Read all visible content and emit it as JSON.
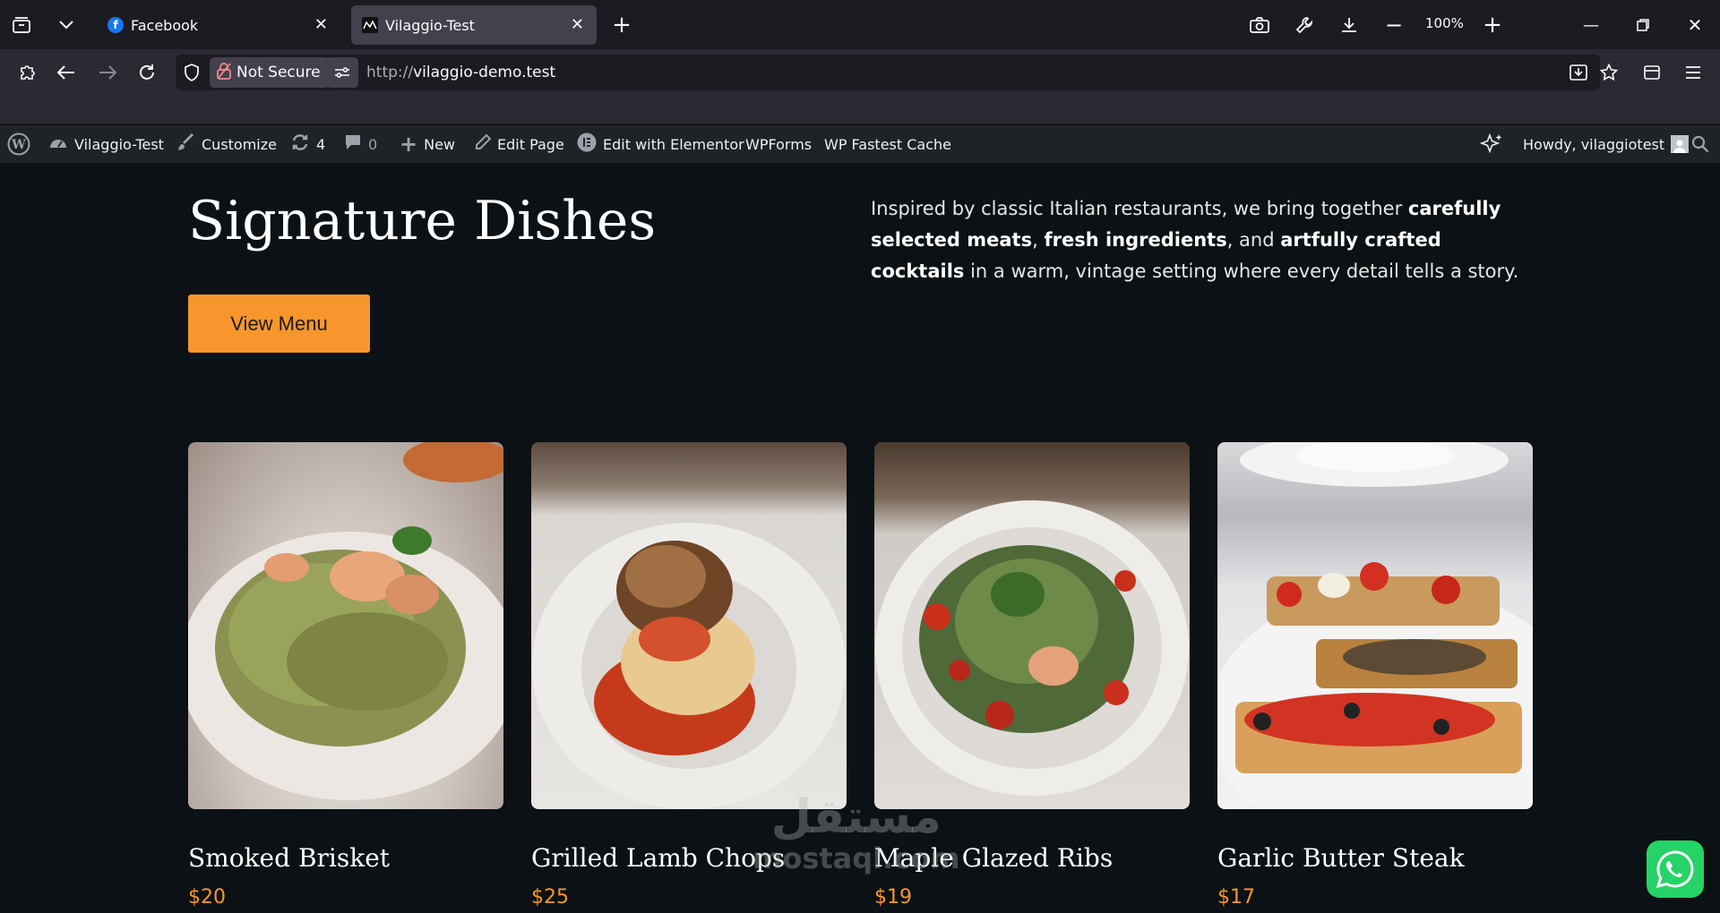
{
  "browser": {
    "tabs": [
      {
        "title": "Facebook",
        "favicon": "facebook-icon",
        "active": false
      },
      {
        "title": "Vilaggio-Test",
        "favicon": "site-icon",
        "active": true
      }
    ],
    "zoom": "100%",
    "security_label": "Not Secure",
    "url_protocol": "http://",
    "url_host": "vilaggio-demo.test"
  },
  "wp_admin_bar": {
    "site_name": "Vilaggio-Test",
    "customize": "Customize",
    "updates_count": "4",
    "comments_count": "0",
    "new": "New",
    "edit_page": "Edit Page",
    "edit_elementor": "Edit with Elementor",
    "wpforms": "WPForms",
    "fastest_cache": "WP Fastest Cache",
    "howdy": "Howdy, vilaggiotest"
  },
  "hero": {
    "title": "Signature Dishes",
    "button": "View Menu",
    "intro_parts": [
      "Inspired by classic Italian restaurants, we bring together ",
      "carefully selected meats",
      ", ",
      "fresh ingredients",
      ", and ",
      "artfully crafted cocktails",
      " in a warm, vintage setting where every detail tells a story."
    ]
  },
  "dishes": [
    {
      "name": "Smoked Brisket",
      "price": "$20"
    },
    {
      "name": "Grilled Lamb Chops",
      "price": "$25"
    },
    {
      "name": "Maple Glazed Ribs",
      "price": "$19"
    },
    {
      "name": "Garlic Butter Steak",
      "price": "$17"
    }
  ],
  "watermark": {
    "arabic": "مستقل",
    "latin": "mostaql.com"
  },
  "colors": {
    "accent": "#f7962d",
    "page_bg": "#0b1114",
    "admin_bar": "#1d2327"
  }
}
